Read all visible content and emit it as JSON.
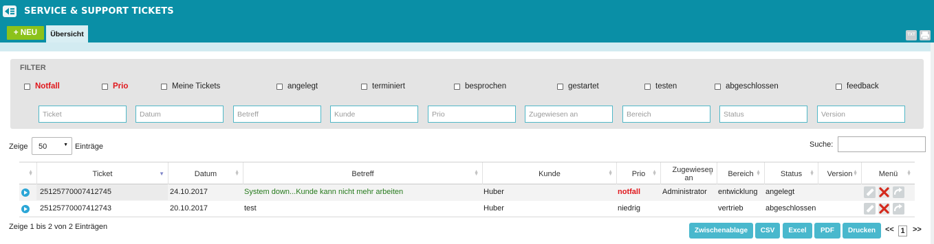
{
  "header": {
    "title": "SERVICE & SUPPORT TICKETS",
    "new_label": "+ NEU",
    "tabs": [
      {
        "label": "Übersicht"
      }
    ],
    "txt_icon_label": "TXT"
  },
  "filter": {
    "title": "FILTER",
    "checkboxes": [
      {
        "label": "Notfall"
      },
      {
        "label": "Prio"
      },
      {
        "label": "Meine Tickets"
      },
      {
        "label": "angelegt"
      },
      {
        "label": "terminiert"
      },
      {
        "label": "besprochen"
      },
      {
        "label": "gestartet"
      },
      {
        "label": "testen"
      },
      {
        "label": "abgeschlossen"
      },
      {
        "label": "feedback"
      }
    ],
    "fields": [
      {
        "placeholder": "Ticket"
      },
      {
        "placeholder": "Datum"
      },
      {
        "placeholder": "Betreff"
      },
      {
        "placeholder": "Kunde"
      },
      {
        "placeholder": "Prio"
      },
      {
        "placeholder": "Zugewiesen an"
      },
      {
        "placeholder": "Bereich"
      },
      {
        "placeholder": "Status"
      },
      {
        "placeholder": "Version"
      }
    ]
  },
  "controls": {
    "show_label": "Zeige",
    "length_value": "50",
    "entries_label": "Einträge",
    "search_label": "Suche:"
  },
  "table": {
    "columns": [
      "Ticket",
      "Datum",
      "Betreff",
      "Kunde",
      "Prio",
      "Zugewiesen an",
      "Bereich",
      "Status",
      "Version",
      "Menü"
    ],
    "rows": [
      {
        "ticket": "25125770007412745",
        "datum": "24.10.2017",
        "betreff": "System down...Kunde kann nicht mehr arbeiten",
        "kunde": "Huber",
        "prio": "notfall",
        "zugewiesen": "Administrator",
        "bereich": "entwicklung",
        "status": "angelegt",
        "version": ""
      },
      {
        "ticket": "25125770007412743",
        "datum": "20.10.2017",
        "betreff": "test",
        "kunde": "Huber",
        "prio": "niedrig",
        "zugewiesen": "",
        "bereich": "vertrieb",
        "status": "abgeschlossen",
        "version": ""
      }
    ]
  },
  "footer": {
    "info": "Zeige 1 bis 2 von 2 Einträgen",
    "buttons": [
      "Zwischenablage",
      "CSV",
      "Excel",
      "PDF",
      "Drucken"
    ],
    "pager": {
      "prev": "<<",
      "current": "1",
      "next": ">>"
    }
  },
  "colors": {
    "header_bg": "#0a8fa6",
    "new_button": "#8cc21a",
    "export_button": "#49b8cd",
    "alert_red": "#e0161b",
    "subject_green": "#267a1c"
  }
}
